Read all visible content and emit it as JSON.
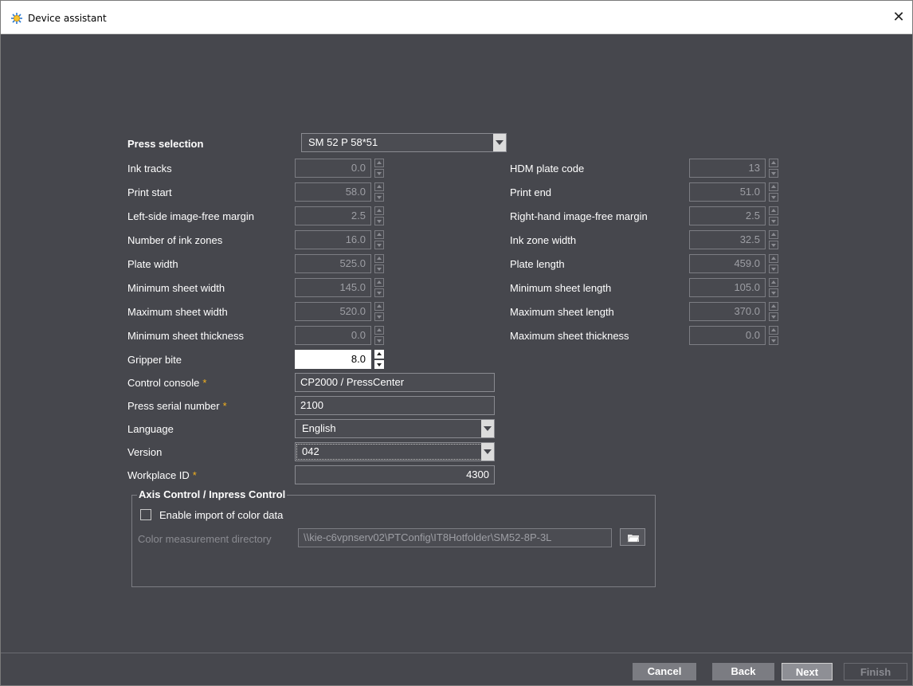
{
  "window": {
    "title": "Device assistant",
    "close_icon": "close-icon",
    "app_icon": "sun-gear-icon"
  },
  "press_selection": {
    "label": "Press selection",
    "value": "SM 52 P 58*51"
  },
  "left_fields": [
    {
      "label": "Ink tracks",
      "value": "0.0"
    },
    {
      "label": "Print start",
      "value": "58.0"
    },
    {
      "label": "Left-side image-free margin",
      "value": "2.5"
    },
    {
      "label": "Number of ink zones",
      "value": "16.0"
    },
    {
      "label": "Plate width",
      "value": "525.0"
    },
    {
      "label": "Minimum sheet width",
      "value": "145.0"
    },
    {
      "label": "Maximum sheet width",
      "value": "520.0"
    },
    {
      "label": "Minimum sheet thickness",
      "value": "0.0"
    },
    {
      "label": "Gripper bite",
      "value": "8.0"
    }
  ],
  "right_fields": [
    {
      "label": "HDM plate code",
      "value": "13"
    },
    {
      "label": "Print end",
      "value": "51.0"
    },
    {
      "label": "Right-hand image-free margin",
      "value": "2.5"
    },
    {
      "label": "Ink zone width",
      "value": "32.5"
    },
    {
      "label": "Plate length",
      "value": "459.0"
    },
    {
      "label": "Minimum sheet length",
      "value": "105.0"
    },
    {
      "label": "Maximum sheet length",
      "value": "370.0"
    },
    {
      "label": "Maximum sheet thickness",
      "value": "0.0"
    }
  ],
  "control_console": {
    "label": "Control console",
    "required": "*",
    "value": "CP2000 / PressCenter"
  },
  "press_serial": {
    "label": "Press serial number",
    "required": "*",
    "value": "2100"
  },
  "language": {
    "label": "Language",
    "value": "English"
  },
  "version": {
    "label": "Version",
    "value": "042"
  },
  "workplace_id": {
    "label": "Workplace ID",
    "required": "*",
    "value": "4300"
  },
  "axis_control": {
    "title": "Axis Control / Inpress Control",
    "enable_import_label": "Enable import of color data",
    "enable_import_checked": false,
    "color_dir_label": "Color measurement directory",
    "color_dir_value": "\\\\kie-c6vpnserv02\\PTConfig\\IT8Hotfolder\\SM52-8P-3L",
    "browse_icon": "folder-browse-icon"
  },
  "footer": {
    "cancel": "Cancel",
    "back": "Back",
    "next": "Next",
    "finish": "Finish"
  }
}
